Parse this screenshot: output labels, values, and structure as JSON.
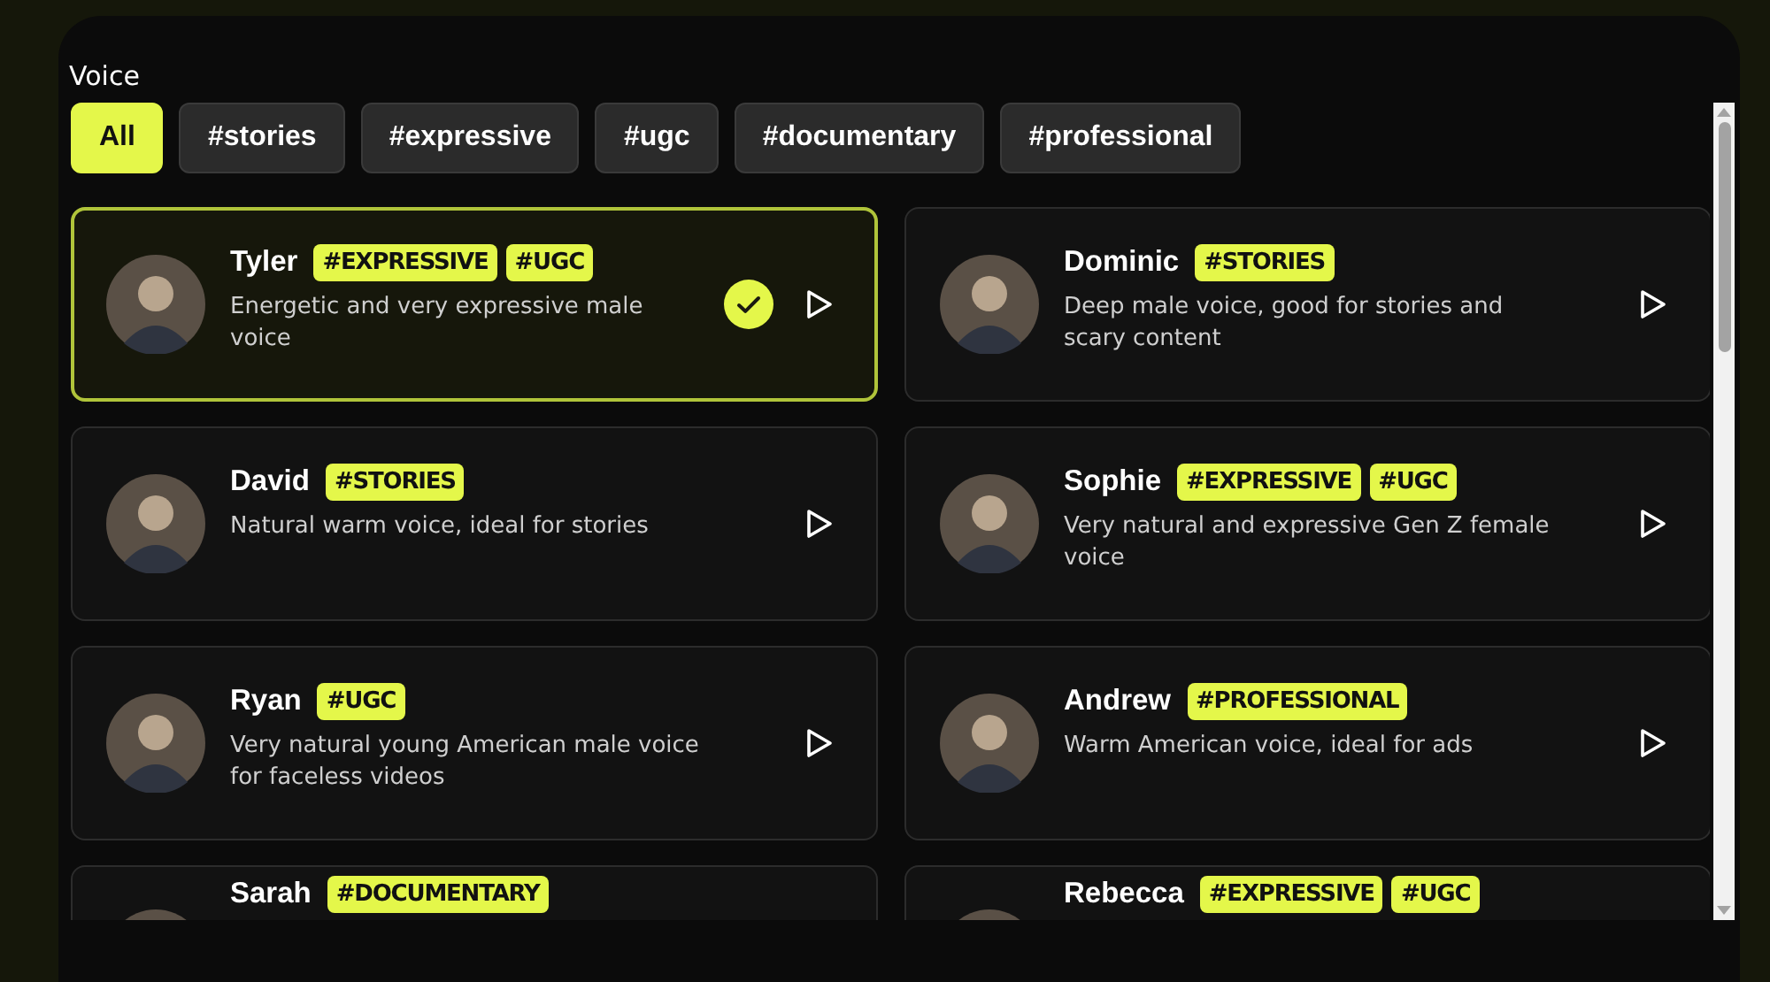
{
  "title": "Voice",
  "filters": [
    {
      "label": "All",
      "selected": true
    },
    {
      "label": "#stories",
      "selected": false
    },
    {
      "label": "#expressive",
      "selected": false
    },
    {
      "label": "#ugc",
      "selected": false
    },
    {
      "label": "#documentary",
      "selected": false
    },
    {
      "label": "#professional",
      "selected": false
    }
  ],
  "voices": [
    {
      "name": "Tyler",
      "tags": [
        "#EXPRESSIVE",
        "#UGC"
      ],
      "description": "Energetic and very expressive male voice",
      "selected": true
    },
    {
      "name": "Dominic",
      "tags": [
        "#STORIES"
      ],
      "description": "Deep male voice, good for stories and scary content",
      "selected": false
    },
    {
      "name": "David",
      "tags": [
        "#STORIES"
      ],
      "description": "Natural warm voice, ideal for stories",
      "selected": false
    },
    {
      "name": "Sophie",
      "tags": [
        "#EXPRESSIVE",
        "#UGC"
      ],
      "description": "Very natural and expressive Gen Z female voice",
      "selected": false
    },
    {
      "name": "Ryan",
      "tags": [
        "#UGC"
      ],
      "description": "Very natural young American male voice for faceless videos",
      "selected": false
    },
    {
      "name": "Andrew",
      "tags": [
        "#PROFESSIONAL"
      ],
      "description": "Warm American voice, ideal for ads",
      "selected": false
    },
    {
      "name": "Sarah",
      "tags": [
        "#DOCUMENTARY"
      ],
      "selected": false
    },
    {
      "name": "Rebecca",
      "tags": [
        "#EXPRESSIVE",
        "#UGC"
      ],
      "selected": false
    }
  ]
}
